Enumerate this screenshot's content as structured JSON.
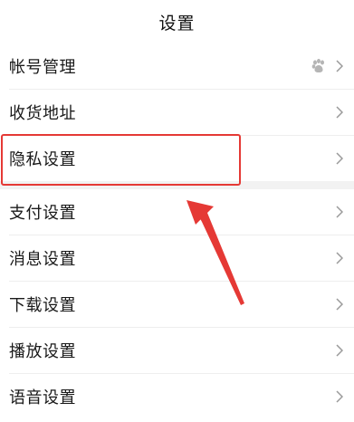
{
  "header": {
    "title": "设置"
  },
  "settings": {
    "items": [
      {
        "label": "帐号管理",
        "icon": "baidu-paw-icon"
      },
      {
        "label": "收货地址"
      },
      {
        "label": "隐私设置",
        "highlighted": true
      },
      {
        "label": "支付设置"
      },
      {
        "label": "消息设置"
      },
      {
        "label": "下载设置"
      },
      {
        "label": "播放设置"
      },
      {
        "label": "语音设置"
      }
    ]
  },
  "annotation": {
    "highlight_color": "#e53935",
    "arrow_color": "#e53935",
    "arrow_target": "隐私设置"
  },
  "colors": {
    "background": "#ffffff",
    "section_gap": "#f2f2f2",
    "chevron": "#9a9a9a",
    "text": "#1a1a1a"
  }
}
